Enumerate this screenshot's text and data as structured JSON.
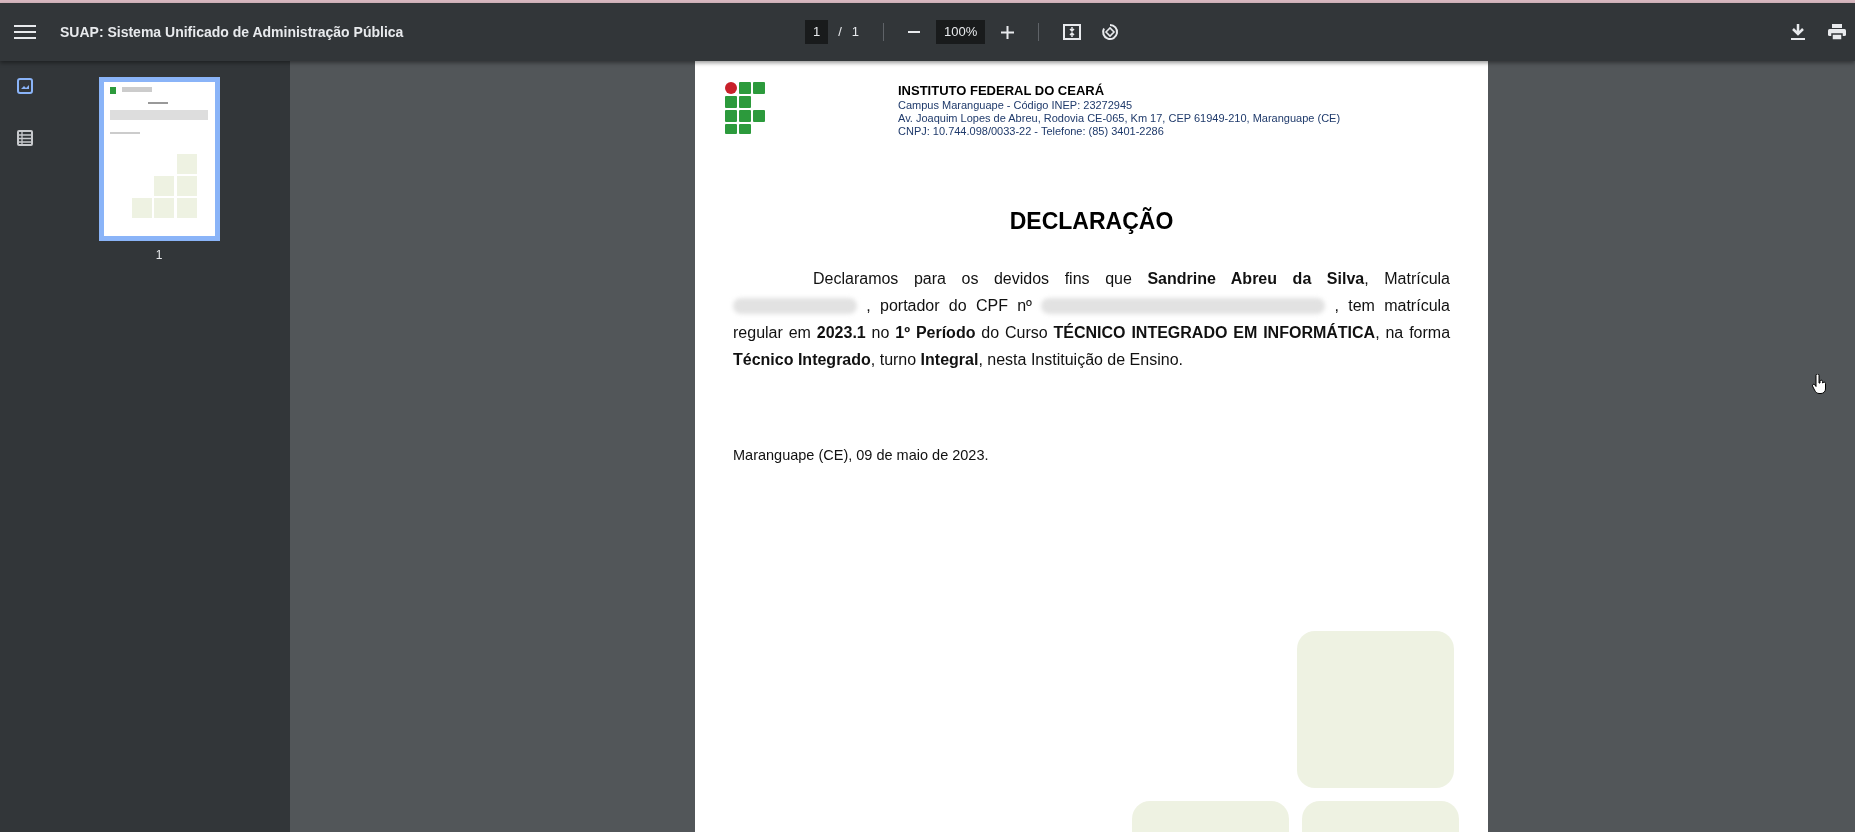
{
  "toolbar": {
    "title": "SUAP: Sistema Unificado de Administração Pública",
    "page_input": "1",
    "page_separator": "/",
    "page_count": "1",
    "zoom": "100%"
  },
  "sidebar": {
    "views": [
      {
        "kind": "thumbnails",
        "selected": true
      },
      {
        "kind": "outline",
        "selected": false
      }
    ],
    "thumbnails": [
      {
        "label": "1",
        "selected": true
      }
    ]
  },
  "document": {
    "institution": "INSTITUTO FEDERAL DO CEARÁ",
    "header_lines": [
      "Campus Maranguape - Código INEP: 23272945",
      "Av. Joaquim Lopes de Abreu, Rodovia CE-065, Km 17, CEP 61949-210, Maranguape (CE)",
      "CNPJ: 10.744.098/0033-22 - Telefone: (85) 3401-2286"
    ],
    "title": "DECLARAÇÃO",
    "paragraph": [
      {
        "kind": "text",
        "text": "Declaramos para os devidos fins que **Sandrine Abreu da Silva**, Matrícula"
      },
      {
        "kind": "redacted"
      },
      {
        "kind": "text",
        "text": ", portador do CPF nº"
      },
      {
        "kind": "redacted"
      },
      {
        "kind": "text",
        "text": ", tem matrícula regular em **2023.1** no **1º Período** do Curso **TÉCNICO INTEGRADO EM INFORMÁTICA**, na forma **Técnico Integrado**, turno **Integral**, nesta Instituição de Ensino."
      }
    ],
    "closing": "Maranguape (CE), 09 de maio de 2023."
  }
}
